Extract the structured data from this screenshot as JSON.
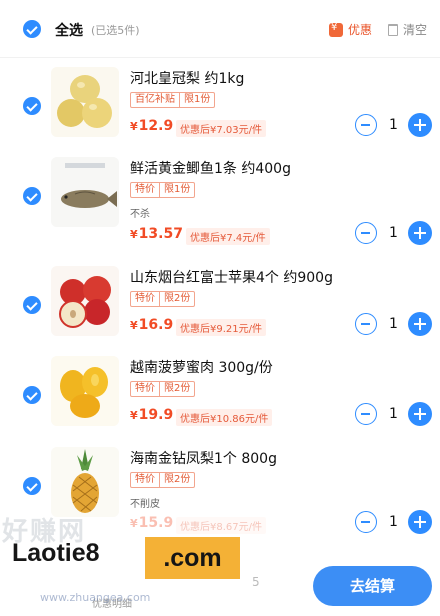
{
  "header": {
    "select_all_label": "全选",
    "selected_count": "(已选5件)",
    "promo_label": "优惠",
    "clear_label": "清空"
  },
  "items": [
    {
      "name": "河北皇冠梨 约1kg",
      "tags": [
        "百亿补贴",
        "限1份"
      ],
      "note": "",
      "currency": "¥",
      "price": "12.9",
      "after_price": "优惠后¥7.03元/件",
      "quantity": "1"
    },
    {
      "name": "鲜活黄金鲫鱼1条 约400g",
      "tags": [
        "特价",
        "限1份"
      ],
      "note": "不杀",
      "currency": "¥",
      "price": "13.57",
      "after_price": "优惠后¥7.4元/件",
      "quantity": "1"
    },
    {
      "name": "山东烟台红富士苹果4个 约900g",
      "tags": [
        "特价",
        "限2份"
      ],
      "note": "",
      "currency": "¥",
      "price": "16.9",
      "after_price": "优惠后¥9.21元/件",
      "quantity": "1"
    },
    {
      "name": "越南菠萝蜜肉 300g/份",
      "tags": [
        "特价",
        "限2份"
      ],
      "note": "",
      "currency": "¥",
      "price": "19.9",
      "after_price": "优惠后¥10.86元/件",
      "quantity": "1"
    },
    {
      "name": "海南金钻凤梨1个 800g",
      "tags": [
        "特价",
        "限2份"
      ],
      "note": "不削皮",
      "currency": "¥",
      "price": "15.9",
      "after_price": "优惠后¥8.67元/件",
      "quantity": "1"
    }
  ],
  "footer": {
    "note": "优惠明细",
    "partial_number": "5",
    "checkout_label": "去结算"
  },
  "watermark": {
    "text": "Laotie8",
    "badge": ".com",
    "sub": "www.zhuangea.com",
    "ghost": "好赚网"
  },
  "colors": {
    "accent_blue": "#2e8cff",
    "price_red": "#f14b25",
    "tag_orange": "#e35b35",
    "watermark_badge": "#f4b136"
  }
}
